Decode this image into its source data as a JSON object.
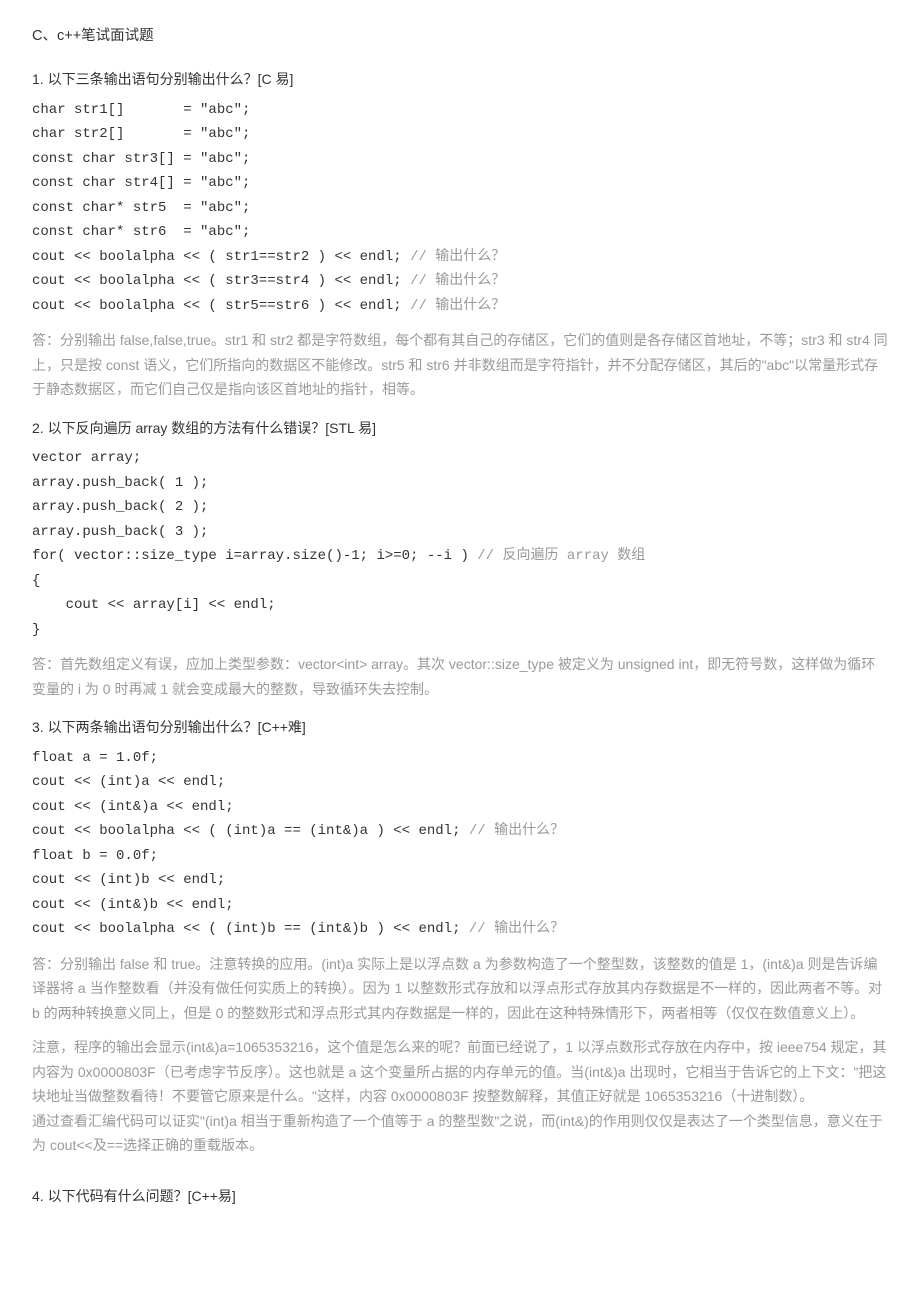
{
  "title": "C、c++笔试面试题",
  "q1": {
    "head": "1.  以下三条输出语句分别输出什么？[C 易]",
    "c1": "char str1[]       = \"abc\";",
    "c2": "char str2[]       = \"abc\";",
    "c3": "const char str3[] = \"abc\";",
    "c4": "const char str4[] = \"abc\";",
    "c5": "const char* str5  = \"abc\";",
    "c6": "const char* str6  = \"abc\";",
    "c7a": "cout << boolalpha << ( str1==str2 ) << endl; ",
    "c7b": "// 输出什么？",
    "c8a": "cout << boolalpha << ( str3==str4 ) << endl; ",
    "c8b": "// 输出什么？",
    "c9a": "cout << boolalpha << ( str5==str6 ) << endl; ",
    "c9b": "// 输出什么？",
    "ans": "答：分别输出 false,false,true。str1 和 str2 都是字符数组，每个都有其自己的存储区，它们的值则是各存储区首地址，不等；str3 和 str4 同上，只是按 const 语义，它们所指向的数据区不能修改。str5 和 str6 并非数组而是字符指针，并不分配存储区，其后的\"abc\"以常量形式存于静态数据区，而它们自己仅是指向该区首地址的指针，相等。"
  },
  "q2": {
    "head": "2.  以下反向遍历 array 数组的方法有什么错误？[STL 易]",
    "c1": "vector array;",
    "c2": "array.push_back( 1 );",
    "c3": "array.push_back( 2 );",
    "c4": "array.push_back( 3 );",
    "c5a": "for( vector::size_type i=array.size()-1; i>=0; --i ) ",
    "c5b": "// 反向遍历 array 数组",
    "c6": "{",
    "c7": "    cout << array[i] << endl;",
    "c8": "}",
    "ans": "答：首先数组定义有误，应加上类型参数：vector<int> array。其次 vector::size_type 被定义为 unsigned int，即无符号数，这样做为循环变量的 i 为 0 时再减 1 就会变成最大的整数，导致循环失去控制。"
  },
  "q3": {
    "head": "3.  以下两条输出语句分别输出什么？[C++难]",
    "c1": "float a = 1.0f;",
    "c2": "cout << (int)a << endl;",
    "c3": "cout << (int&)a << endl;",
    "c4a": "cout << boolalpha << ( (int)a == (int&)a ) << endl; ",
    "c4b": "// 输出什么？",
    "c5": "float b = 0.0f;",
    "c6": "cout << (int)b << endl;",
    "c7": "cout << (int&)b << endl;",
    "c8a": "cout << boolalpha << ( (int)b == (int&)b ) << endl; ",
    "c8b": "// 输出什么？",
    "ans": "答：分别输出 false 和 true。注意转换的应用。(int)a 实际上是以浮点数 a 为参数构造了一个整型数，该整数的值是 1，(int&)a 则是告诉编译器将 a 当作整数看（并没有做任何实质上的转换）。因为 1 以整数形式存放和以浮点形式存放其内存数据是不一样的，因此两者不等。对 b 的两种转换意义同上，但是 0 的整数形式和浮点形式其内存数据是一样的，因此在这种特殊情形下，两者相等（仅仅在数值意义上）。",
    "note1": "注意，程序的输出会显示(int&)a=1065353216，这个值是怎么来的呢？前面已经说了，1 以浮点数形式存放在内存中，按 ieee754 规定，其内容为 0x0000803F（已考虑字节反序）。这也就是 a 这个变量所占据的内存单元的值。当(int&)a 出现时，它相当于告诉它的上下文：\"把这块地址当做整数看待！不要管它原来是什么。\"这样，内容 0x0000803F 按整数解释，其值正好就是 1065353216（十进制数）。",
    "note2": "通过查看汇编代码可以证实\"(int)a 相当于重新构造了一个值等于 a 的整型数\"之说，而(int&)的作用则仅仅是表达了一个类型信息，意义在于为 cout<<及==选择正确的重载版本。"
  },
  "q4": {
    "head": "4.  以下代码有什么问题？[C++易]"
  }
}
